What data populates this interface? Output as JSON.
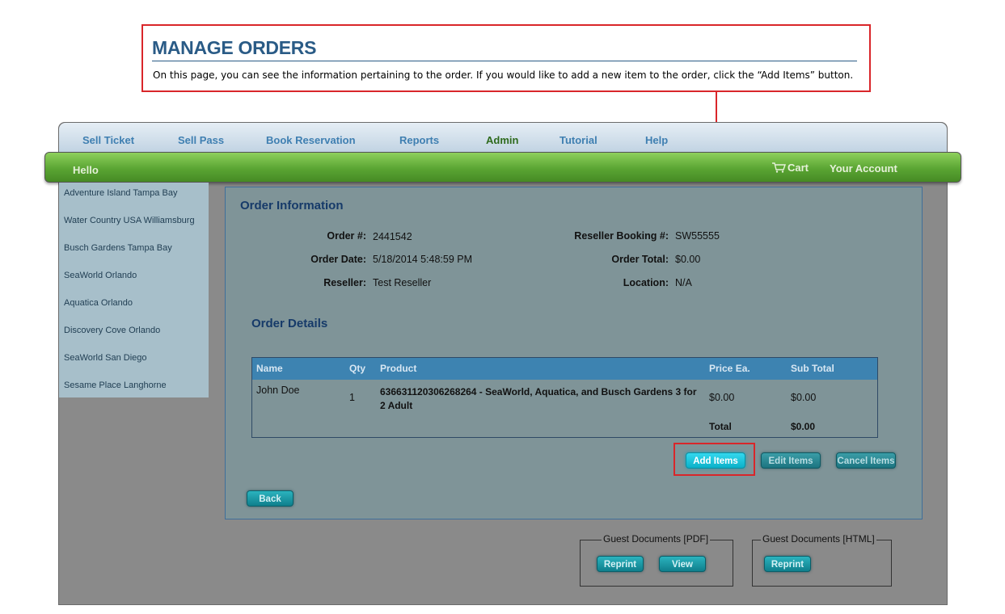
{
  "callout": {
    "title": "MANAGE ORDERS",
    "description": "On this page, you can see the information pertaining to the order. If you would like to add a new item to the order, click the “Add Items” button."
  },
  "nav": {
    "items": [
      "Sell Ticket",
      "Sell Pass",
      "Book Reservation",
      "Reports",
      "Admin",
      "Tutorial",
      "Help"
    ],
    "active": "Admin"
  },
  "header": {
    "greeting": "Hello",
    "cart_label": "Cart",
    "account_label": "Your Account"
  },
  "sidebar": {
    "items": [
      "Adventure Island Tampa Bay",
      "Water Country USA Williamsburg",
      "Busch Gardens Tampa Bay",
      "SeaWorld Orlando",
      "Aquatica Orlando",
      "Discovery Cove Orlando",
      "SeaWorld San Diego",
      "Sesame Place Langhorne"
    ]
  },
  "order": {
    "heading": "Order Information",
    "order_num_label": "Order #:",
    "order_num": "2441542",
    "order_date_label": "Order Date:",
    "order_date": "5/18/2014 5:48:59 PM",
    "reseller_label": "Reseller:",
    "reseller": "Test Reseller",
    "booking_label": "Reseller Booking #:",
    "booking": "SW55555",
    "total_label": "Order Total:",
    "total": "$0.00",
    "location_label": "Location:",
    "location": "N/A"
  },
  "details": {
    "heading": "Order Details",
    "columns": [
      "Name",
      "Qty",
      "Product",
      "Price Ea.",
      "Sub Total"
    ],
    "rows": [
      {
        "name": "John Doe",
        "qty": "1",
        "product": "636631120306268264 - SeaWorld, Aquatica, and Busch Gardens 3 for 2 Adult",
        "price": "$0.00",
        "subtotal": "$0.00"
      }
    ],
    "total_label": "Total",
    "total_value": "$0.00"
  },
  "actions": {
    "add": "Add Items",
    "edit": "Edit Items",
    "cancel": "Cancel Items",
    "back": "Back"
  },
  "documents": {
    "pdf_legend": "Guest Documents [PDF]",
    "html_legend": "Guest Documents [HTML]",
    "reprint": "Reprint",
    "view": "View"
  }
}
